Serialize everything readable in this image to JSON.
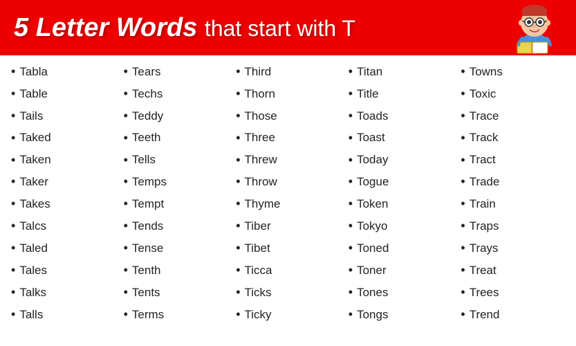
{
  "header": {
    "bold_part": "5 Letter Words",
    "normal_part": " that start with T"
  },
  "columns": [
    {
      "words": [
        "Tabla",
        "Table",
        "Tails",
        "Taked",
        "Taken",
        "Taker",
        "Takes",
        "Talcs",
        "Taled",
        "Tales",
        "Talks",
        "Talls"
      ]
    },
    {
      "words": [
        "Tears",
        "Techs",
        "Teddy",
        "Teeth",
        "Tells",
        "Temps",
        "Tempt",
        "Tends",
        "Tense",
        "Tenth",
        "Tents",
        "Terms"
      ]
    },
    {
      "words": [
        "Third",
        "Thorn",
        "Those",
        "Three",
        "Threw",
        "Throw",
        "Thyme",
        "Tiber",
        "Tibet",
        "Ticca",
        "Ticks",
        "Ticky"
      ]
    },
    {
      "words": [
        "Titan",
        "Title",
        "Toads",
        "Toast",
        "Today",
        "Togue",
        "Token",
        "Tokyo",
        "Toned",
        "Toner",
        "Tones",
        "Tongs"
      ]
    },
    {
      "words": [
        "Towns",
        "Toxic",
        "Trace",
        "Track",
        "Tract",
        "Trade",
        "Train",
        "Traps",
        "Trays",
        "Treat",
        "Trees",
        "Trend"
      ]
    }
  ]
}
